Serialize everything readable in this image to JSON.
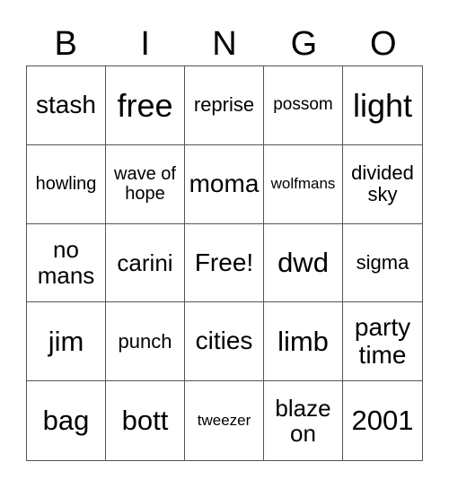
{
  "header": {
    "letters": [
      "B",
      "I",
      "N",
      "G",
      "O"
    ]
  },
  "cells": [
    "stash",
    "free",
    "reprise",
    "possom",
    "light",
    "howling",
    "wave of hope",
    "moma",
    "wolfmans",
    "divided sky",
    "no mans",
    "carini",
    "Free!",
    "dwd",
    "sigma",
    "jim",
    "punch",
    "cities",
    "limb",
    "party time",
    "bag",
    "bott",
    "tweezer",
    "blaze on",
    "2001"
  ]
}
